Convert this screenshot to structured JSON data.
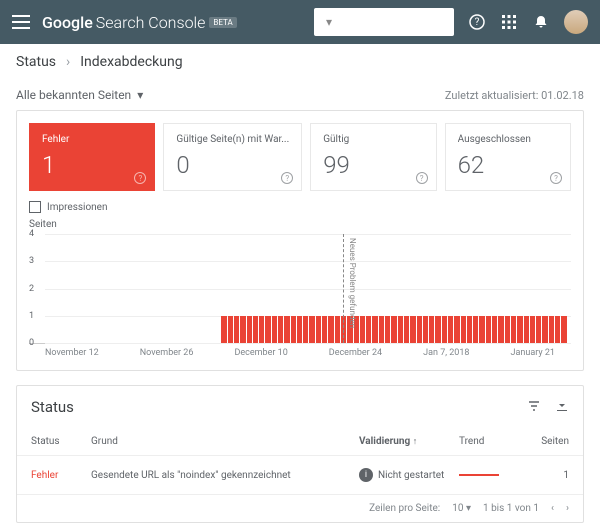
{
  "header": {
    "logo_g": "Google",
    "logo_s": "Search Console",
    "beta": "BETA"
  },
  "breadcrumb": {
    "parent": "Status",
    "current": "Indexabdeckung"
  },
  "filter": {
    "label": "Alle bekannten Seiten"
  },
  "updated": {
    "label": "Zuletzt aktualisiert: 01.02.18"
  },
  "metrics": [
    {
      "label": "Fehler",
      "value": "1",
      "active": true
    },
    {
      "label": "Gültige Seite(n) mit War...",
      "value": "0"
    },
    {
      "label": "Gültig",
      "value": "99"
    },
    {
      "label": "Ausgeschlossen",
      "value": "62"
    }
  ],
  "impressions": {
    "label": "Impressionen"
  },
  "chart_data": {
    "type": "bar",
    "ylabel": "Seiten",
    "ylim": [
      0,
      4
    ],
    "yticks": [
      0,
      1,
      2,
      3,
      4
    ],
    "xticks": [
      "November 12",
      "November 26",
      "December 10",
      "December 24",
      "Jan 7, 2018",
      "January 21"
    ],
    "annotation": {
      "x_fraction": 0.55,
      "label": "Neues Problem gefunden"
    },
    "values": [
      0,
      0,
      0,
      0,
      0,
      0,
      0,
      0,
      0,
      0,
      0,
      0,
      0,
      0,
      0,
      0,
      0,
      0,
      0,
      0,
      0,
      0,
      0,
      0,
      0,
      0,
      0,
      0,
      1,
      1,
      1,
      1,
      1,
      1,
      1,
      1,
      1,
      1,
      1,
      1,
      1,
      1,
      1,
      1,
      1,
      1,
      1,
      1,
      1,
      1,
      1,
      1,
      1,
      1,
      1,
      1,
      1,
      1,
      1,
      1,
      1,
      1,
      1,
      1,
      1,
      1,
      1,
      1,
      1,
      1,
      1,
      1,
      1,
      1,
      1,
      1,
      1,
      1,
      1,
      1,
      1,
      1,
      1
    ]
  },
  "table": {
    "title": "Status",
    "columns": [
      "Status",
      "Grund",
      "Validierung",
      "Trend",
      "Seiten"
    ],
    "sort_indicator": "↑",
    "rows": [
      {
        "status": "Fehler",
        "reason": "Gesendete URL als \"noindex\" gekennzeichnet",
        "validation": "Nicht gestartet",
        "pages": "1"
      }
    ],
    "pager": {
      "rows_label": "Zeilen pro Seite:",
      "rows_value": "10",
      "range": "1 bis 1 von 1"
    }
  }
}
